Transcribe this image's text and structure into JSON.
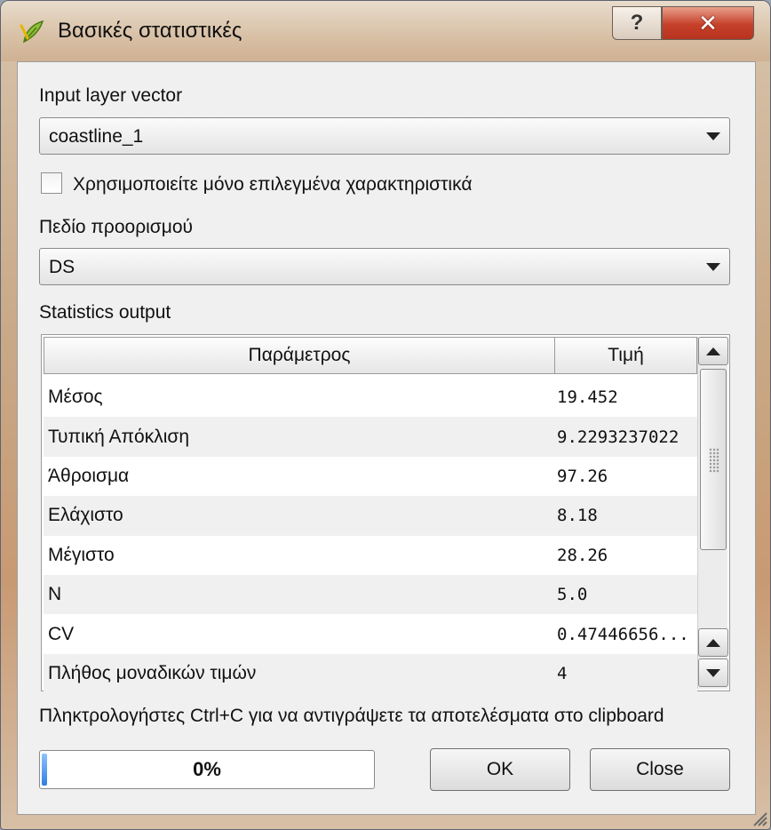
{
  "window": {
    "title": "Βασικές στατιστικές",
    "help_glyph": "?",
    "close_glyph": "✕",
    "app_icon": "qgis-leaf-icon"
  },
  "form": {
    "input_layer_label": "Input layer vector",
    "input_layer_value": "coastline_1",
    "selected_only_label": "Χρησιμοποιείτε μόνο επιλεγμένα χαρακτηριστικά",
    "selected_only_checked": false,
    "target_field_label": "Πεδίο προορισμού",
    "target_field_value": "DS",
    "stats_output_label": "Statistics output"
  },
  "table": {
    "columns": [
      "Παράμετρος",
      "Τιμή"
    ],
    "rows": [
      {
        "param": "Μέσος",
        "value": "19.452"
      },
      {
        "param": "Τυπική Απόκλιση",
        "value": "9.2293237022"
      },
      {
        "param": "Άθροισμα",
        "value": "97.26"
      },
      {
        "param": "Ελάχιστο",
        "value": "8.18"
      },
      {
        "param": "Μέγιστο",
        "value": "28.26"
      },
      {
        "param": "N",
        "value": "5.0"
      },
      {
        "param": "CV",
        "value": "0.47446656..."
      },
      {
        "param": "Πλήθος μοναδικών τιμών",
        "value": "4"
      }
    ]
  },
  "hint": "Πληκτρολογήστες Ctrl+C για να αντιγράψετε τα αποτελέσματα στο clipboard",
  "progress": {
    "text": "0%",
    "value": 0
  },
  "buttons": {
    "ok": "OK",
    "close": "Close"
  },
  "colors": {
    "accent": "#2f7fe0",
    "titlebar": "#d9c2a8",
    "close_button": "#c6402a"
  }
}
